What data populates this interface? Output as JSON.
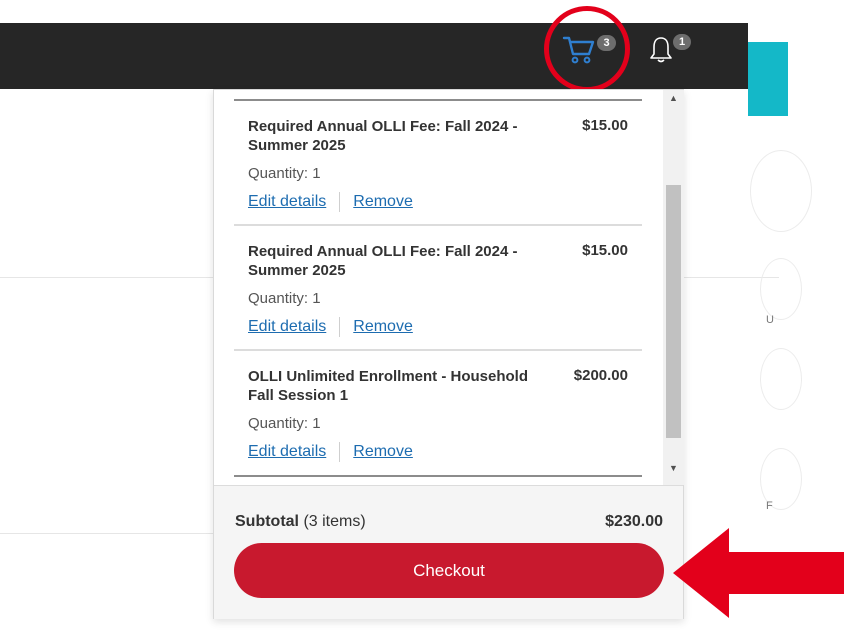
{
  "header": {
    "cart_count": "3",
    "notification_count": "1",
    "icons": [
      "cart-icon",
      "bell-icon"
    ]
  },
  "cart": {
    "items": [
      {
        "name": "Required Annual OLLI Fee: Fall 2024 - Summer 2025",
        "price": "$15.00",
        "quantity": "Quantity: 1",
        "edit_label": "Edit details",
        "remove_label": "Remove"
      },
      {
        "name": "Required Annual OLLI Fee: Fall 2024 - Summer 2025",
        "price": "$15.00",
        "quantity": "Quantity: 1",
        "edit_label": "Edit details",
        "remove_label": "Remove"
      },
      {
        "name": "OLLI Unlimited Enrollment - Household Fall Session 1",
        "price": "$200.00",
        "quantity": "Quantity: 1",
        "edit_label": "Edit details",
        "remove_label": "Remove"
      }
    ],
    "subtotal_label": "Subtotal",
    "subtotal_count": "(3 items)",
    "subtotal_amount": "$230.00",
    "checkout_label": "Checkout"
  },
  "background": {
    "side_letters": [
      "U",
      "F"
    ]
  },
  "colors": {
    "topbar": "#262626",
    "accent_teal": "#14b8c8",
    "checkout": "#c8192e",
    "link": "#1d6cb0",
    "annotation_red": "#e3001b",
    "cart_icon": "#2f7fd0"
  }
}
